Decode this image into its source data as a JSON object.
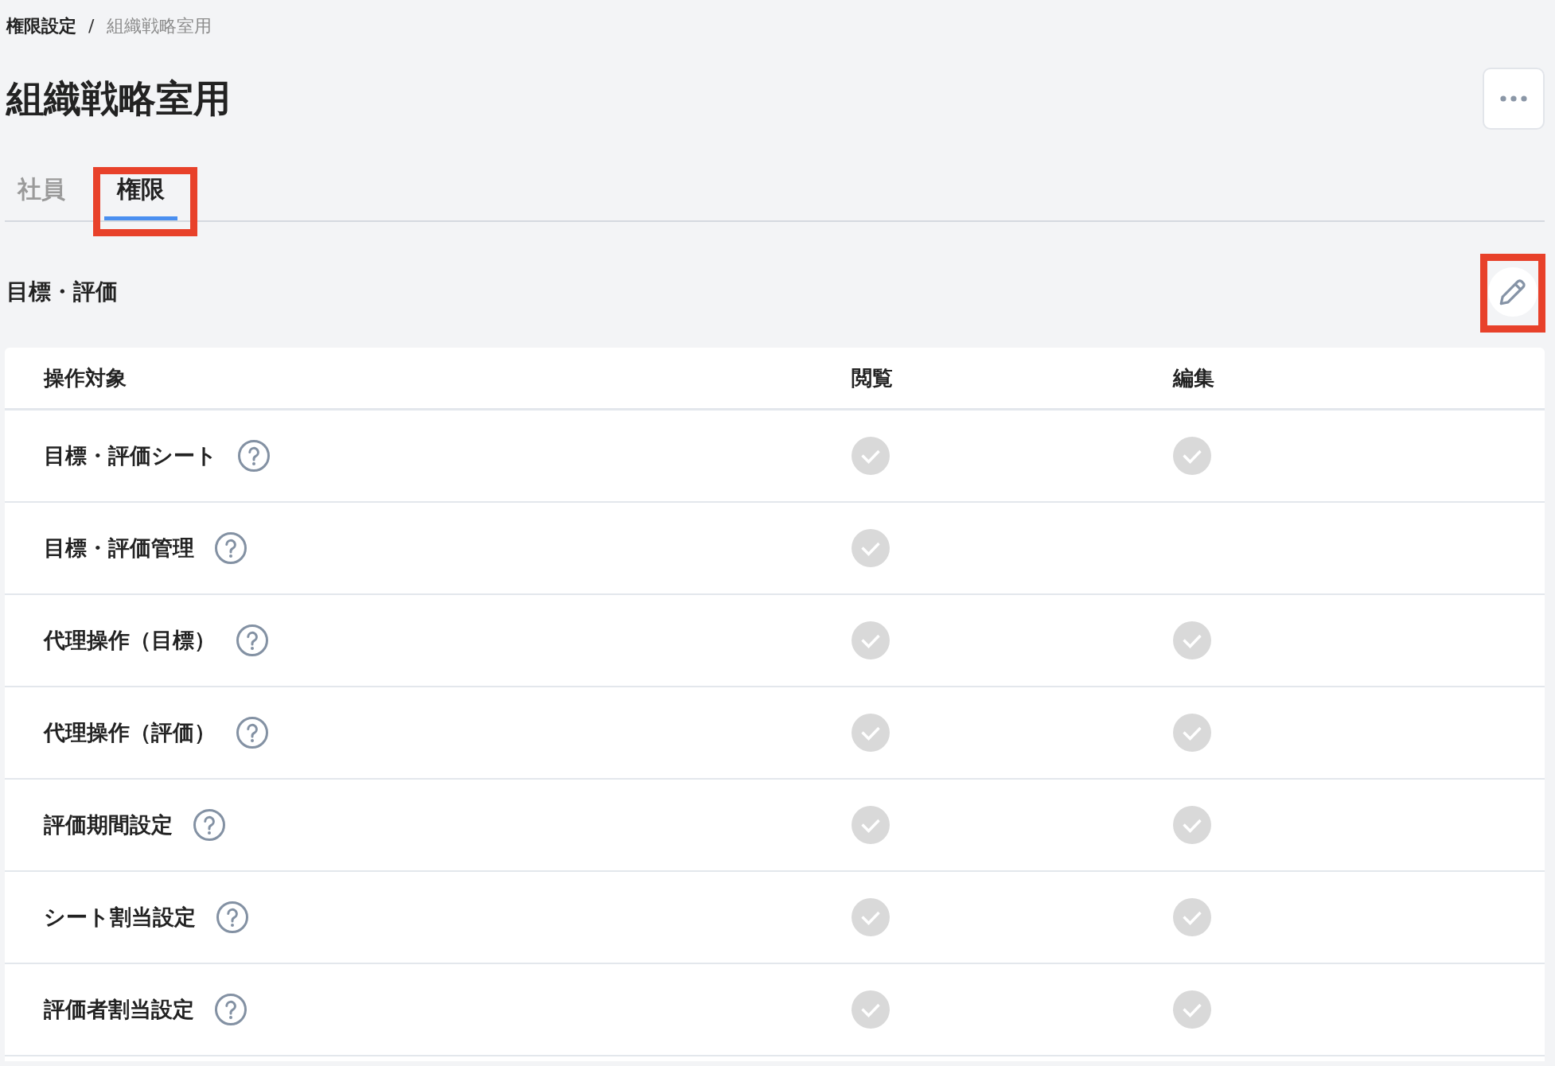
{
  "breadcrumb": {
    "items": [
      {
        "label": "権限設定",
        "current": false
      },
      {
        "label": "組織戦略室用",
        "current": true
      }
    ],
    "separator": "/"
  },
  "page_title": "組織戦略室用",
  "header_actions": [
    {
      "kind": "more"
    }
  ],
  "tabs": [
    {
      "label": "社員",
      "selected": false,
      "highlighted": false
    },
    {
      "label": "権限",
      "selected": true,
      "highlighted": true
    }
  ],
  "section": {
    "title": "目標・評価",
    "actions": [
      {
        "kind": "edit",
        "highlighted": true
      }
    ],
    "table": {
      "columns": [
        {
          "label": "操作対象"
        },
        {
          "label": "閲覧"
        },
        {
          "label": "編集"
        }
      ],
      "rows": [
        {
          "label": "目標・評価シート",
          "has_help": true,
          "view": true,
          "edit": true
        },
        {
          "label": "目標・評価管理",
          "has_help": true,
          "view": true,
          "edit": false
        },
        {
          "label": "代理操作（目標）",
          "has_help": true,
          "view": true,
          "edit": true
        },
        {
          "label": "代理操作（評価）",
          "has_help": true,
          "view": true,
          "edit": true
        },
        {
          "label": "評価期間設定",
          "has_help": true,
          "view": true,
          "edit": true
        },
        {
          "label": "シート割当設定",
          "has_help": true,
          "view": true,
          "edit": true
        },
        {
          "label": "評価者割当設定",
          "has_help": true,
          "view": true,
          "edit": true
        }
      ]
    }
  }
}
